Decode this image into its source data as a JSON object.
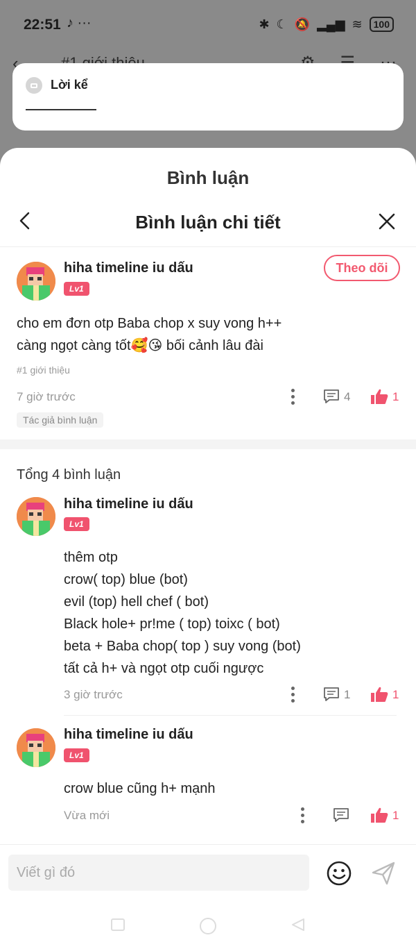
{
  "status_bar": {
    "time": "22:51",
    "left_icons": "♪ ···",
    "battery": "100"
  },
  "behind": {
    "title": "#1 giới thiệu"
  },
  "narration": {
    "label": "Lời kể"
  },
  "sheet": {
    "title": "Bình luận"
  },
  "detail": {
    "title": "Bình luận chi tiết"
  },
  "main_comment": {
    "username": "hiha timeline iu dấu",
    "level": "Lv1",
    "follow_label": "Theo dõi",
    "text": "cho em đơn otp Baba chop x suy vong h++\ncàng ngọt càng tốt🥰😘 bối cảnh lâu đài",
    "chapter": "#1 giới thiệu",
    "time": "7 giờ trước",
    "reply_count": "4",
    "like_count": "1",
    "author_tag": "Tác giả bình luận"
  },
  "total_label": "Tổng 4 bình luận",
  "replies": [
    {
      "username": "hiha timeline iu dấu",
      "level": "Lv1",
      "text": "thêm otp\ncrow( top) blue (bot)\nevil (top) hell chef ( bot)\nBlack hole+ pr!me ( top) toixc ( bot)\nbeta + Baba chop( top ) suy vong (bot)\ntất cả h+ và ngọt otp cuối ngược",
      "time": "3 giờ trước",
      "reply_count": "1",
      "like_count": "1"
    },
    {
      "username": "hiha timeline iu dấu",
      "level": "Lv1",
      "text": "crow blue cũng h+ mạnh",
      "time": "Vừa mới",
      "reply_count": "",
      "like_count": "1"
    }
  ],
  "input": {
    "placeholder": "Viết gì đó"
  },
  "colors": {
    "accent": "#f0536e",
    "muted": "#999999"
  }
}
